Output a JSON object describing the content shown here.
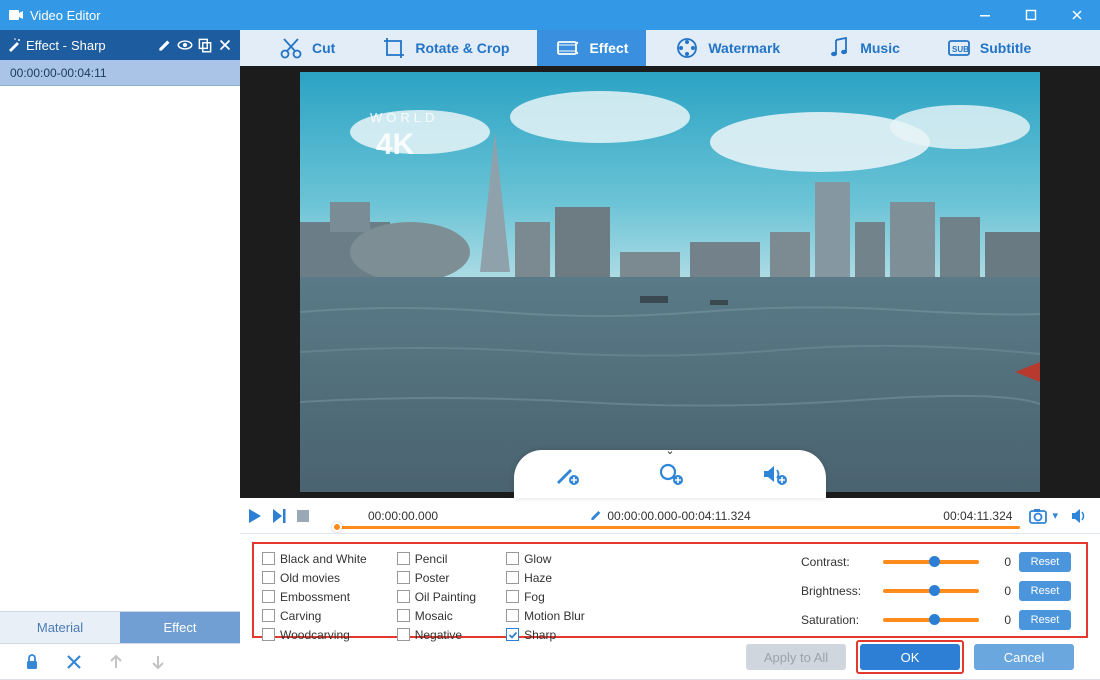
{
  "window": {
    "title": "Video Editor"
  },
  "sidebar": {
    "header_prefix": "Effect - ",
    "header_name": "Sharp",
    "clip_range": "00:00:00-00:04:11",
    "tabs": {
      "material": "Material",
      "effect": "Effect"
    }
  },
  "toolbar": {
    "cut": "Cut",
    "rotate": "Rotate & Crop",
    "effect": "Effect",
    "watermark": "Watermark",
    "music": "Music",
    "subtitle": "Subtitle"
  },
  "timeline": {
    "start": "00:00:00.000",
    "range": "00:00:00.000-00:04:11.324",
    "end": "00:04:11.324"
  },
  "effects": {
    "col1": [
      "Black and White",
      "Old movies",
      "Embossment",
      "Carving",
      "Woodcarving"
    ],
    "col2": [
      "Pencil",
      "Poster",
      "Oil Painting",
      "Mosaic",
      "Negative"
    ],
    "col3": [
      "Glow",
      "Haze",
      "Fog",
      "Motion Blur",
      "Sharp"
    ],
    "checked": "Sharp"
  },
  "sliders": {
    "contrast": {
      "label": "Contrast:",
      "value": "0",
      "reset": "Reset"
    },
    "brightness": {
      "label": "Brightness:",
      "value": "0",
      "reset": "Reset"
    },
    "saturation": {
      "label": "Saturation:",
      "value": "0",
      "reset": "Reset"
    }
  },
  "buttons": {
    "apply_all": "Apply to All",
    "ok": "OK",
    "cancel": "Cancel"
  }
}
